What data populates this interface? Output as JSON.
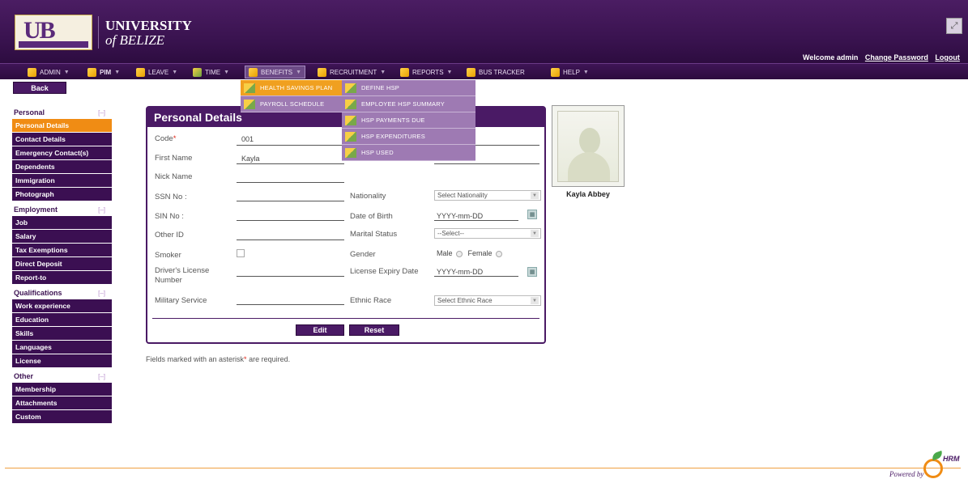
{
  "header": {
    "logo_text": "UB",
    "university_line1": "UNIVERSITY",
    "university_line2": "of BELIZE",
    "welcome": "Welcome admin",
    "change_password": "Change Password",
    "logout": "Logout"
  },
  "menu": [
    {
      "label": "Admin",
      "style": "smallcaps",
      "caret": true
    },
    {
      "label": "PIM",
      "style": "bold",
      "caret": true
    },
    {
      "label": "Leave",
      "style": "smallcaps",
      "caret": true
    },
    {
      "label": "Time",
      "style": "smallcaps",
      "caret": true
    },
    {
      "label": "Benefits",
      "style": "smallcaps",
      "caret": true,
      "active": true
    },
    {
      "label": "Recruitment",
      "style": "smallcaps",
      "caret": true
    },
    {
      "label": "Reports",
      "style": "smallcaps",
      "caret": true
    },
    {
      "label": "Bus Tracker",
      "style": "smallcaps",
      "caret": false
    },
    {
      "label": "Help",
      "style": "smallcaps",
      "caret": true
    }
  ],
  "benefits_dropdown": [
    "Health Savings Plan",
    "Payroll Schedule"
  ],
  "hsp_submenu": [
    "Define HSP",
    "Employee HSP Summary",
    "HSP Payments Due",
    "HSP Expenditures",
    "HSP Used"
  ],
  "back_label": "Back",
  "leftnav": [
    {
      "section": "Personal",
      "toggle": "[–]",
      "items": [
        "Personal Details",
        "Contact Details",
        "Emergency Contact(s)",
        "Dependents",
        "Immigration",
        "Photograph"
      ],
      "current": 0
    },
    {
      "section": "Employment",
      "toggle": "[–]",
      "items": [
        "Job",
        "Salary",
        "Tax Exemptions",
        "Direct Deposit",
        "Report-to"
      ]
    },
    {
      "section": "Qualifications",
      "toggle": "[–]",
      "items": [
        "Work experience",
        "Education",
        "Skills",
        "Languages",
        "License"
      ]
    },
    {
      "section": "Other",
      "toggle": "[–]",
      "items": [
        "Membership",
        "Attachments",
        "Custom"
      ]
    }
  ],
  "form": {
    "title": "Personal Details",
    "code_label": "Code",
    "code_value": "001",
    "first_name_label": "First Name",
    "first_name_value": "Kayla",
    "nick_name_label": "Nick Name",
    "ssn_label": "SSN No :",
    "sin_label": "SIN No :",
    "other_id_label": "Other ID",
    "smoker_label": "Smoker",
    "license_label": "Driver's License Number",
    "military_label": "Military Service",
    "nationality_label": "Nationality",
    "nationality_value": "Select Nationality",
    "dob_label": "Date of Birth",
    "dob_value": "YYYY-mm-DD",
    "marital_label": "Marital Status",
    "marital_value": "--Select--",
    "gender_label": "Gender",
    "gender_male": "Male",
    "gender_female": "Female",
    "license_expiry_label": "License Expiry Date",
    "license_expiry_value": "YYYY-mm-DD",
    "ethnic_label": "Ethnic Race",
    "ethnic_value": "Select Ethnic Race",
    "edit_button": "Edit",
    "reset_button": "Reset"
  },
  "employee_name": "Kayla Abbey",
  "required_note_a": "Fields marked with an asterisk",
  "required_note_b": "are required.",
  "footer": {
    "powered_by": "Powered by",
    "brand": "HRM"
  },
  "colors": {
    "brand_purple": "#4a1a65",
    "accent_orange": "#f08c14",
    "dropdown_purple": "#9e7ab3"
  }
}
